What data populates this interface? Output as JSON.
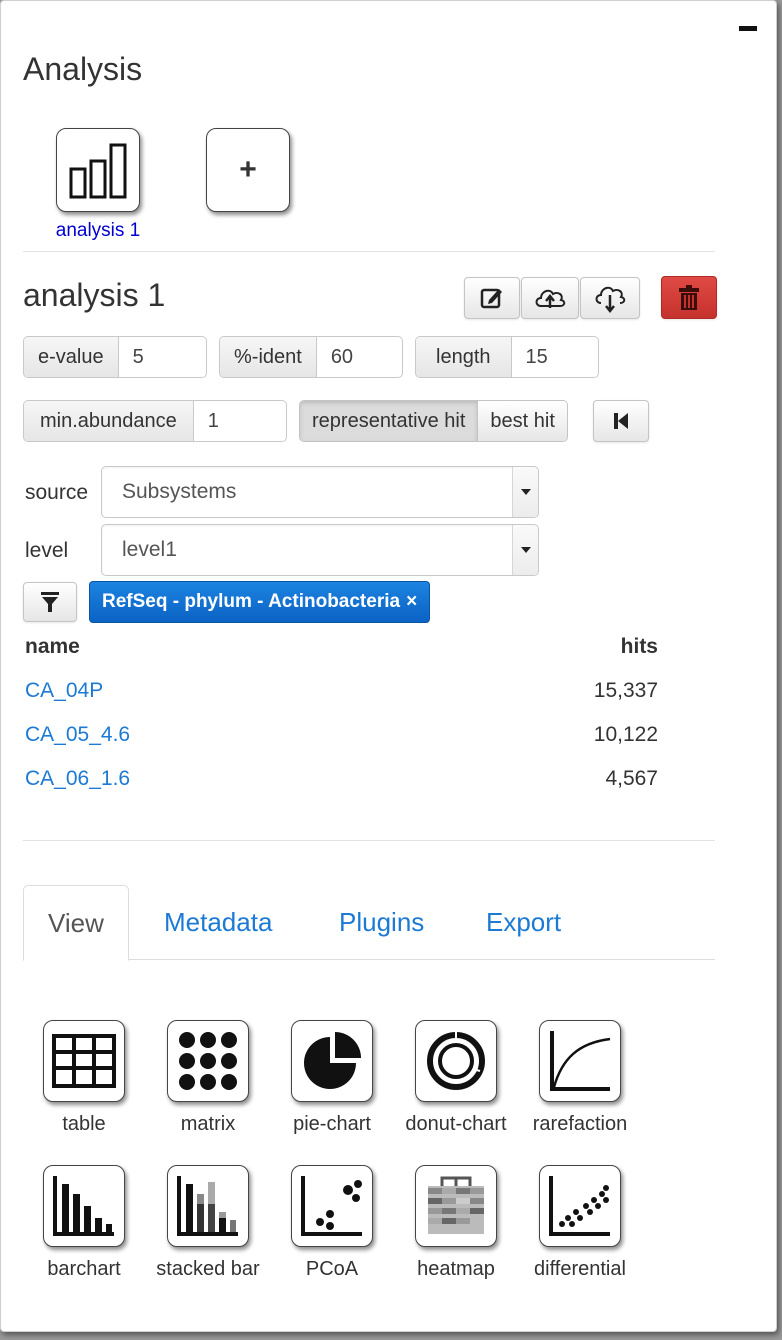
{
  "panel": {
    "title": "Analysis",
    "minimize_icon": "minimize-icon"
  },
  "analyses": [
    {
      "label": "analysis 1",
      "icon": "bar-chart-icon"
    }
  ],
  "add_analysis": {
    "label": "+"
  },
  "current": {
    "title": "analysis 1",
    "actions": [
      "edit-icon",
      "upload-cloud-icon",
      "download-cloud-icon",
      "trash-icon"
    ]
  },
  "params": {
    "evalue": {
      "label": "e-value",
      "value": "5"
    },
    "ident": {
      "label": "%-ident",
      "value": "60"
    },
    "length": {
      "label": "length",
      "value": "15"
    },
    "min_abundance": {
      "label": "min.abundance",
      "value": "1"
    },
    "hit_type": {
      "options": [
        "representative hit",
        "best hit"
      ],
      "selected": "representative hit"
    }
  },
  "source": {
    "label": "source",
    "value": "Subsystems"
  },
  "level": {
    "label": "level",
    "value": "level1"
  },
  "filter": {
    "tag": "RefSeq - phylum - Actinobacteria",
    "close": "×"
  },
  "table": {
    "headers": {
      "name": "name",
      "hits": "hits"
    },
    "rows": [
      {
        "name": "CA_04P",
        "hits": "15,337"
      },
      {
        "name": "CA_05_4.6",
        "hits": "10,122"
      },
      {
        "name": "CA_06_1.6",
        "hits": "4,567"
      }
    ]
  },
  "tabs": [
    "View",
    "Metadata",
    "Plugins",
    "Export"
  ],
  "active_tab": "View",
  "views": [
    {
      "label": "table",
      "icon": "table-icon"
    },
    {
      "label": "matrix",
      "icon": "matrix-icon"
    },
    {
      "label": "pie-chart",
      "icon": "pie-chart-icon"
    },
    {
      "label": "donut-chart",
      "icon": "donut-chart-icon"
    },
    {
      "label": "rarefaction",
      "icon": "rarefaction-icon"
    },
    {
      "label": "barchart",
      "icon": "barchart-icon"
    },
    {
      "label": "stacked bar",
      "icon": "stacked-bar-icon"
    },
    {
      "label": "PCoA",
      "icon": "pcoa-icon"
    },
    {
      "label": "heatmap",
      "icon": "heatmap-icon"
    },
    {
      "label": "differential",
      "icon": "differential-icon"
    }
  ],
  "colors": {
    "link": "#1d7ad4",
    "analysis_label": "#0000d0",
    "tag": "#0b63c4",
    "danger": "#d03a35"
  }
}
